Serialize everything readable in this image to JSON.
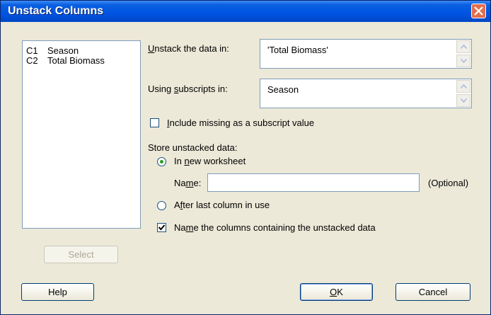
{
  "window": {
    "title": "Unstack Columns"
  },
  "columns_list": [
    {
      "id": "C1",
      "name": "Season"
    },
    {
      "id": "C2",
      "name": "Total Biomass"
    }
  ],
  "unstack": {
    "label_pre": "",
    "label_key": "U",
    "label_post": "nstack the data in:",
    "value": "'Total Biomass'"
  },
  "subscripts": {
    "label_pre": "Using ",
    "label_key": "s",
    "label_post": "ubscripts in:",
    "value": "Season"
  },
  "include_missing": {
    "label_pre": "",
    "label_key": "I",
    "label_post": "nclude missing as a subscript value",
    "checked": false
  },
  "store": {
    "heading": "Store unstacked data:",
    "new_worksheet": {
      "label_pre": "In ",
      "label_key": "n",
      "label_post": "ew worksheet",
      "selected": true
    },
    "name_field": {
      "label_pre": "Na",
      "label_key": "m",
      "label_post": "e:",
      "value": "",
      "optional_label": "(Optional)"
    },
    "after_last": {
      "label_pre": "A",
      "label_key": "f",
      "label_post": "ter last column in use",
      "selected": false
    }
  },
  "name_columns": {
    "label_pre": "Na",
    "label_key": "m",
    "label_post": "e the columns containing the unstacked data",
    "checked": true
  },
  "buttons": {
    "select": "Select",
    "help": "Help",
    "ok_key": "O",
    "ok_rest": "K",
    "cancel": "Cancel"
  }
}
